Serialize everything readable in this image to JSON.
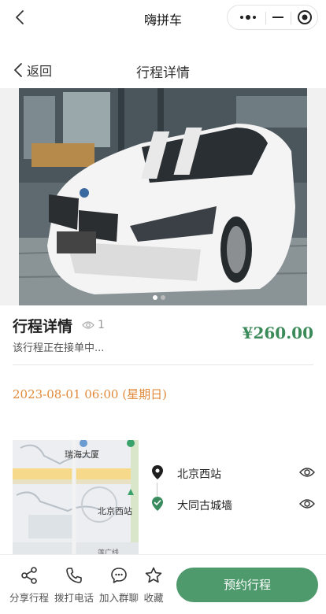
{
  "topbar": {
    "title": "嗨拼车"
  },
  "nav": {
    "back_label": "返回",
    "title": "行程详情"
  },
  "trip": {
    "heading": "行程详情",
    "views": "1",
    "status": "该行程正在接单中...",
    "price": "¥260.00",
    "date": "2023-08-01 06:00 (星期日)"
  },
  "map": {
    "label_building": "瑞海大厦",
    "label_station": "北京西站",
    "label_street": "莲广线"
  },
  "route": {
    "stops": [
      {
        "name": "北京西站",
        "type": "start"
      },
      {
        "name": "大同古城墙",
        "type": "end"
      }
    ]
  },
  "bottom": {
    "share": "分享行程",
    "call": "拨打电话",
    "group": "加入群聊",
    "favorite": "收藏",
    "book": "预约行程"
  },
  "colors": {
    "accent": "#4f9a6d",
    "price": "#3b8a5a",
    "date": "#e08a3a"
  }
}
